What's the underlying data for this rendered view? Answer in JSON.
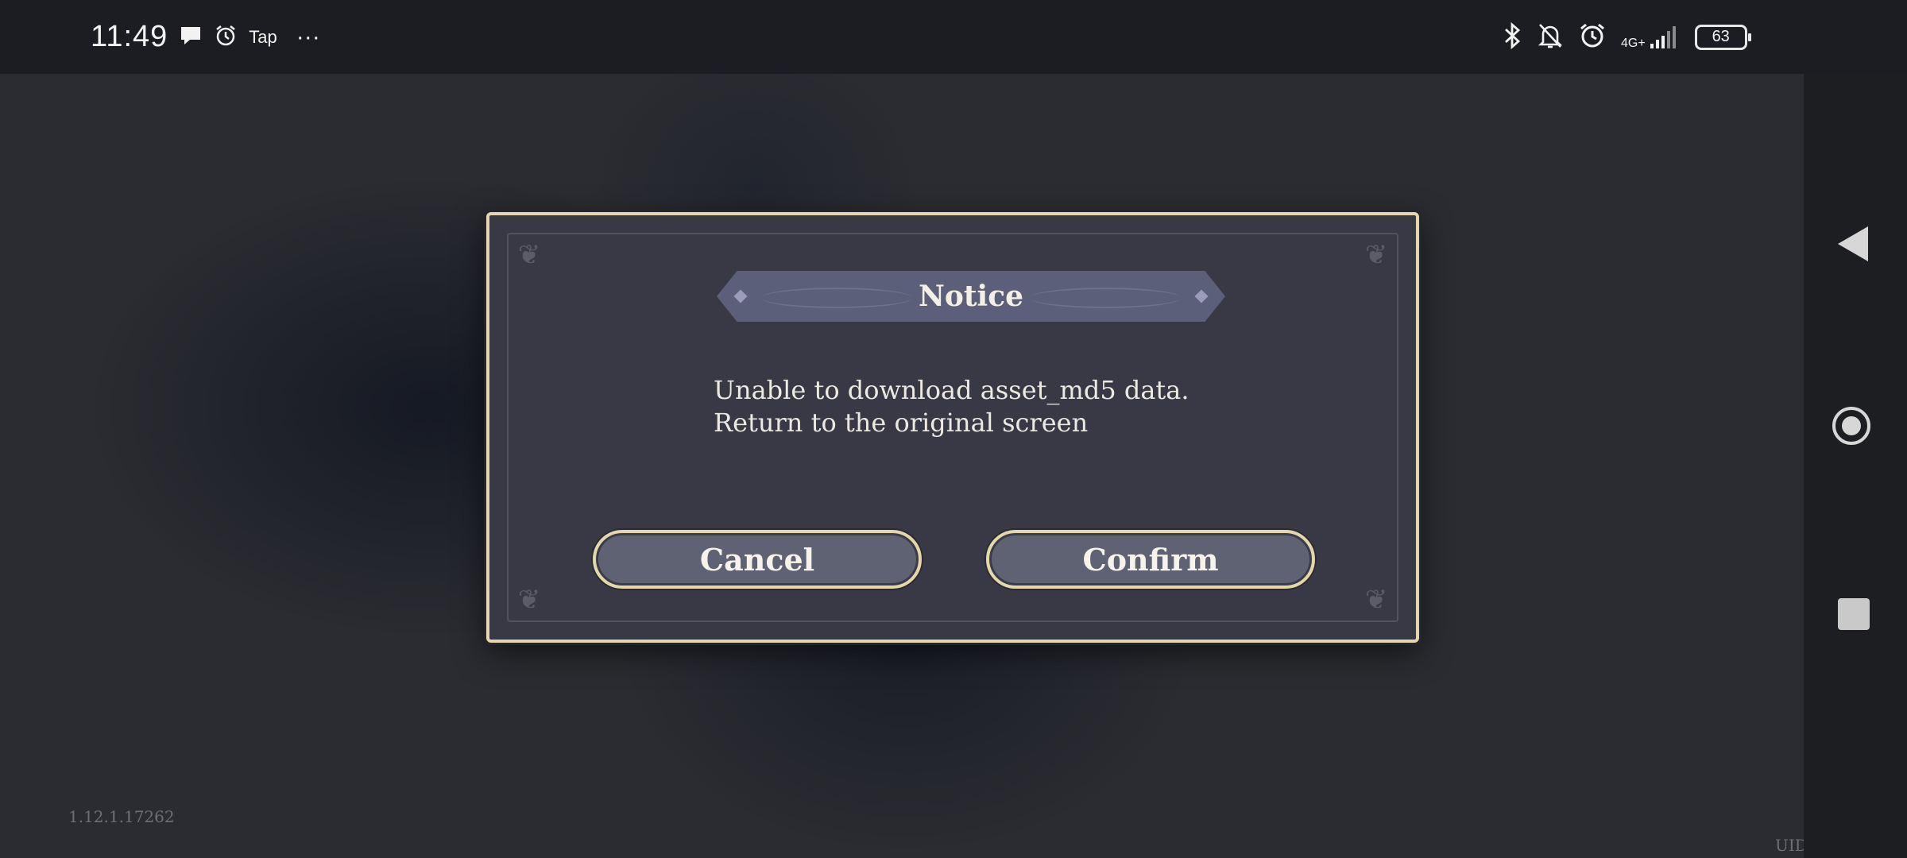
{
  "status_bar": {
    "time": "11:49",
    "tap_label": "Tap",
    "more": "···",
    "network": "4G+",
    "battery": "63"
  },
  "game": {
    "version": "1.12.1.17262",
    "uid_label": "UID"
  },
  "dialog": {
    "title": "Notice",
    "message_lines": [
      "Unable to download asset_md5 data.",
      "Return to the original screen"
    ],
    "cancel_label": "Cancel",
    "confirm_label": "Confirm"
  },
  "icons": {
    "chat": "chat-bubble-icon",
    "alarm": "alarm-icon",
    "bluetooth": "bluetooth-icon",
    "mute": "bell-off-icon",
    "back": "back-triangle-icon",
    "home": "home-circle-icon",
    "recent": "recent-square-icon"
  }
}
